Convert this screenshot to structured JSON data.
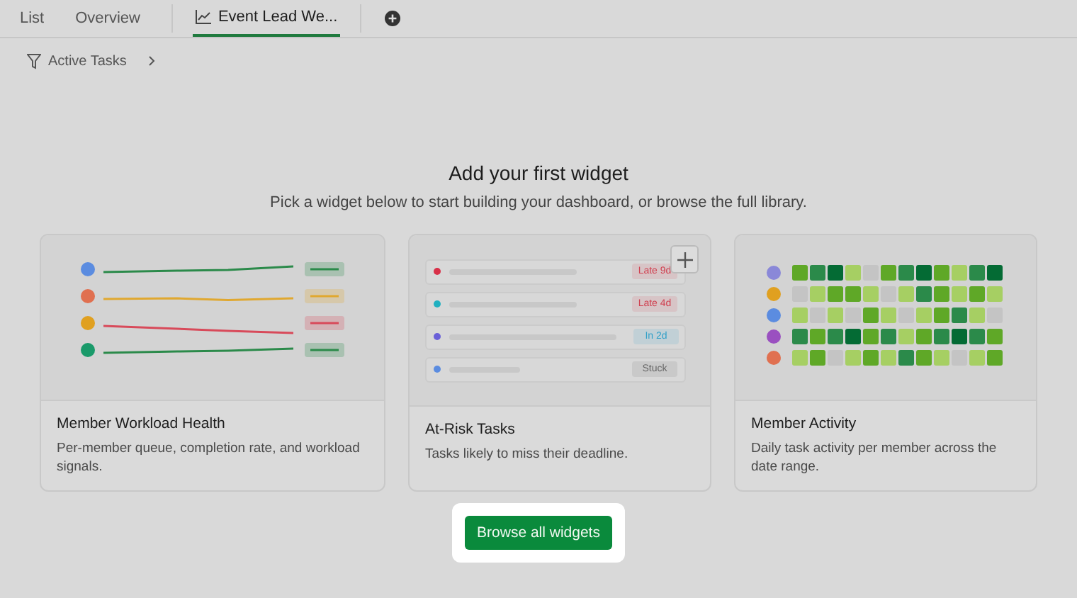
{
  "tabs": [
    {
      "label": "List",
      "selected": false,
      "icon": false
    },
    {
      "label": "Overview",
      "selected": false,
      "icon": false
    },
    {
      "label": "Event Lead We...",
      "selected": true,
      "icon": true
    }
  ],
  "filter": {
    "label": "Active Tasks"
  },
  "heading": "Add your first widget",
  "subheading": "Pick a widget below to start building your dashboard, or browse the full library.",
  "widgets": [
    {
      "kind": "workload",
      "title": "Member Workload Health",
      "description": "Per-member queue, completion rate, and workload signals.",
      "rows": [
        {
          "color": "#5b8ce0",
          "line": {
            "color": "#2b8a4a"
          }
        },
        {
          "color": "#e07050",
          "line": {
            "color": "#e0a830"
          }
        },
        {
          "color": "#e0a020",
          "line": {
            "color": "#d84a5a"
          }
        },
        {
          "color": "#1a9a6a",
          "line": {
            "color": "#2b8a4a"
          }
        }
      ]
    },
    {
      "kind": "risk",
      "title": "At-Risk Tasks",
      "description": "Tasks likely to miss their deadline.",
      "rows": [
        {
          "color": "#d83048",
          "badge": {
            "text": "Late 9d",
            "color": "#d04050"
          }
        },
        {
          "color": "#20b0c0",
          "badge": {
            "text": "Late 4d",
            "color": "#d04050"
          }
        },
        {
          "color": "#6a60d8",
          "badge": {
            "text": "In 2d",
            "color": "#30a0c8"
          }
        },
        {
          "color": "#5b8ce0",
          "badge": {
            "text": "Stuck",
            "color": "#666666"
          }
        }
      ]
    },
    {
      "kind": "activity",
      "title": "Member Activity",
      "description": "Daily task activity per member across the date range.",
      "rows": [
        {
          "color": "#8a88d8",
          "cells": [
            {
              "color": "#5fa827"
            },
            {
              "color": "#2b8a4a"
            },
            {
              "color": "#046b34"
            },
            {
              "color": "#a6cf63"
            },
            {
              "color": "#c4c4c4"
            },
            {
              "color": "#5fa827"
            },
            {
              "color": "#2b8a4a"
            },
            {
              "color": "#046b34"
            },
            {
              "color": "#5fa827"
            },
            {
              "color": "#a6cf63"
            },
            {
              "color": "#2b8a4a"
            },
            {
              "color": "#046b34"
            }
          ]
        },
        {
          "color": "#e0a020",
          "cells": [
            {
              "color": "#c4c4c4"
            },
            {
              "color": "#a6cf63"
            },
            {
              "color": "#5fa827"
            },
            {
              "color": "#5fa827"
            },
            {
              "color": "#a6cf63"
            },
            {
              "color": "#c4c4c4"
            },
            {
              "color": "#a6cf63"
            },
            {
              "color": "#2b8a4a"
            },
            {
              "color": "#5fa827"
            },
            {
              "color": "#a6cf63"
            },
            {
              "color": "#5fa827"
            },
            {
              "color": "#a6cf63"
            }
          ]
        },
        {
          "color": "#5b8ce0",
          "cells": [
            {
              "color": "#a6cf63"
            },
            {
              "color": "#c4c4c4"
            },
            {
              "color": "#a6cf63"
            },
            {
              "color": "#c4c4c4"
            },
            {
              "color": "#5fa827"
            },
            {
              "color": "#a6cf63"
            },
            {
              "color": "#c4c4c4"
            },
            {
              "color": "#a6cf63"
            },
            {
              "color": "#5fa827"
            },
            {
              "color": "#2b8a4a"
            },
            {
              "color": "#a6cf63"
            },
            {
              "color": "#c4c4c4"
            }
          ]
        },
        {
          "color": "#9a50c0",
          "cells": [
            {
              "color": "#2b8a4a"
            },
            {
              "color": "#5fa827"
            },
            {
              "color": "#2b8a4a"
            },
            {
              "color": "#046b34"
            },
            {
              "color": "#5fa827"
            },
            {
              "color": "#2b8a4a"
            },
            {
              "color": "#a6cf63"
            },
            {
              "color": "#5fa827"
            },
            {
              "color": "#2b8a4a"
            },
            {
              "color": "#046b34"
            },
            {
              "color": "#2b8a4a"
            },
            {
              "color": "#5fa827"
            }
          ]
        },
        {
          "color": "#e07050",
          "cells": [
            {
              "color": "#a6cf63"
            },
            {
              "color": "#5fa827"
            },
            {
              "color": "#c4c4c4"
            },
            {
              "color": "#a6cf63"
            },
            {
              "color": "#5fa827"
            },
            {
              "color": "#a6cf63"
            },
            {
              "color": "#2b8a4a"
            },
            {
              "color": "#5fa827"
            },
            {
              "color": "#a6cf63"
            },
            {
              "color": "#c4c4c4"
            },
            {
              "color": "#a6cf63"
            },
            {
              "color": "#5fa827"
            }
          ]
        }
      ]
    }
  ],
  "browse_button": "Browse all widgets"
}
